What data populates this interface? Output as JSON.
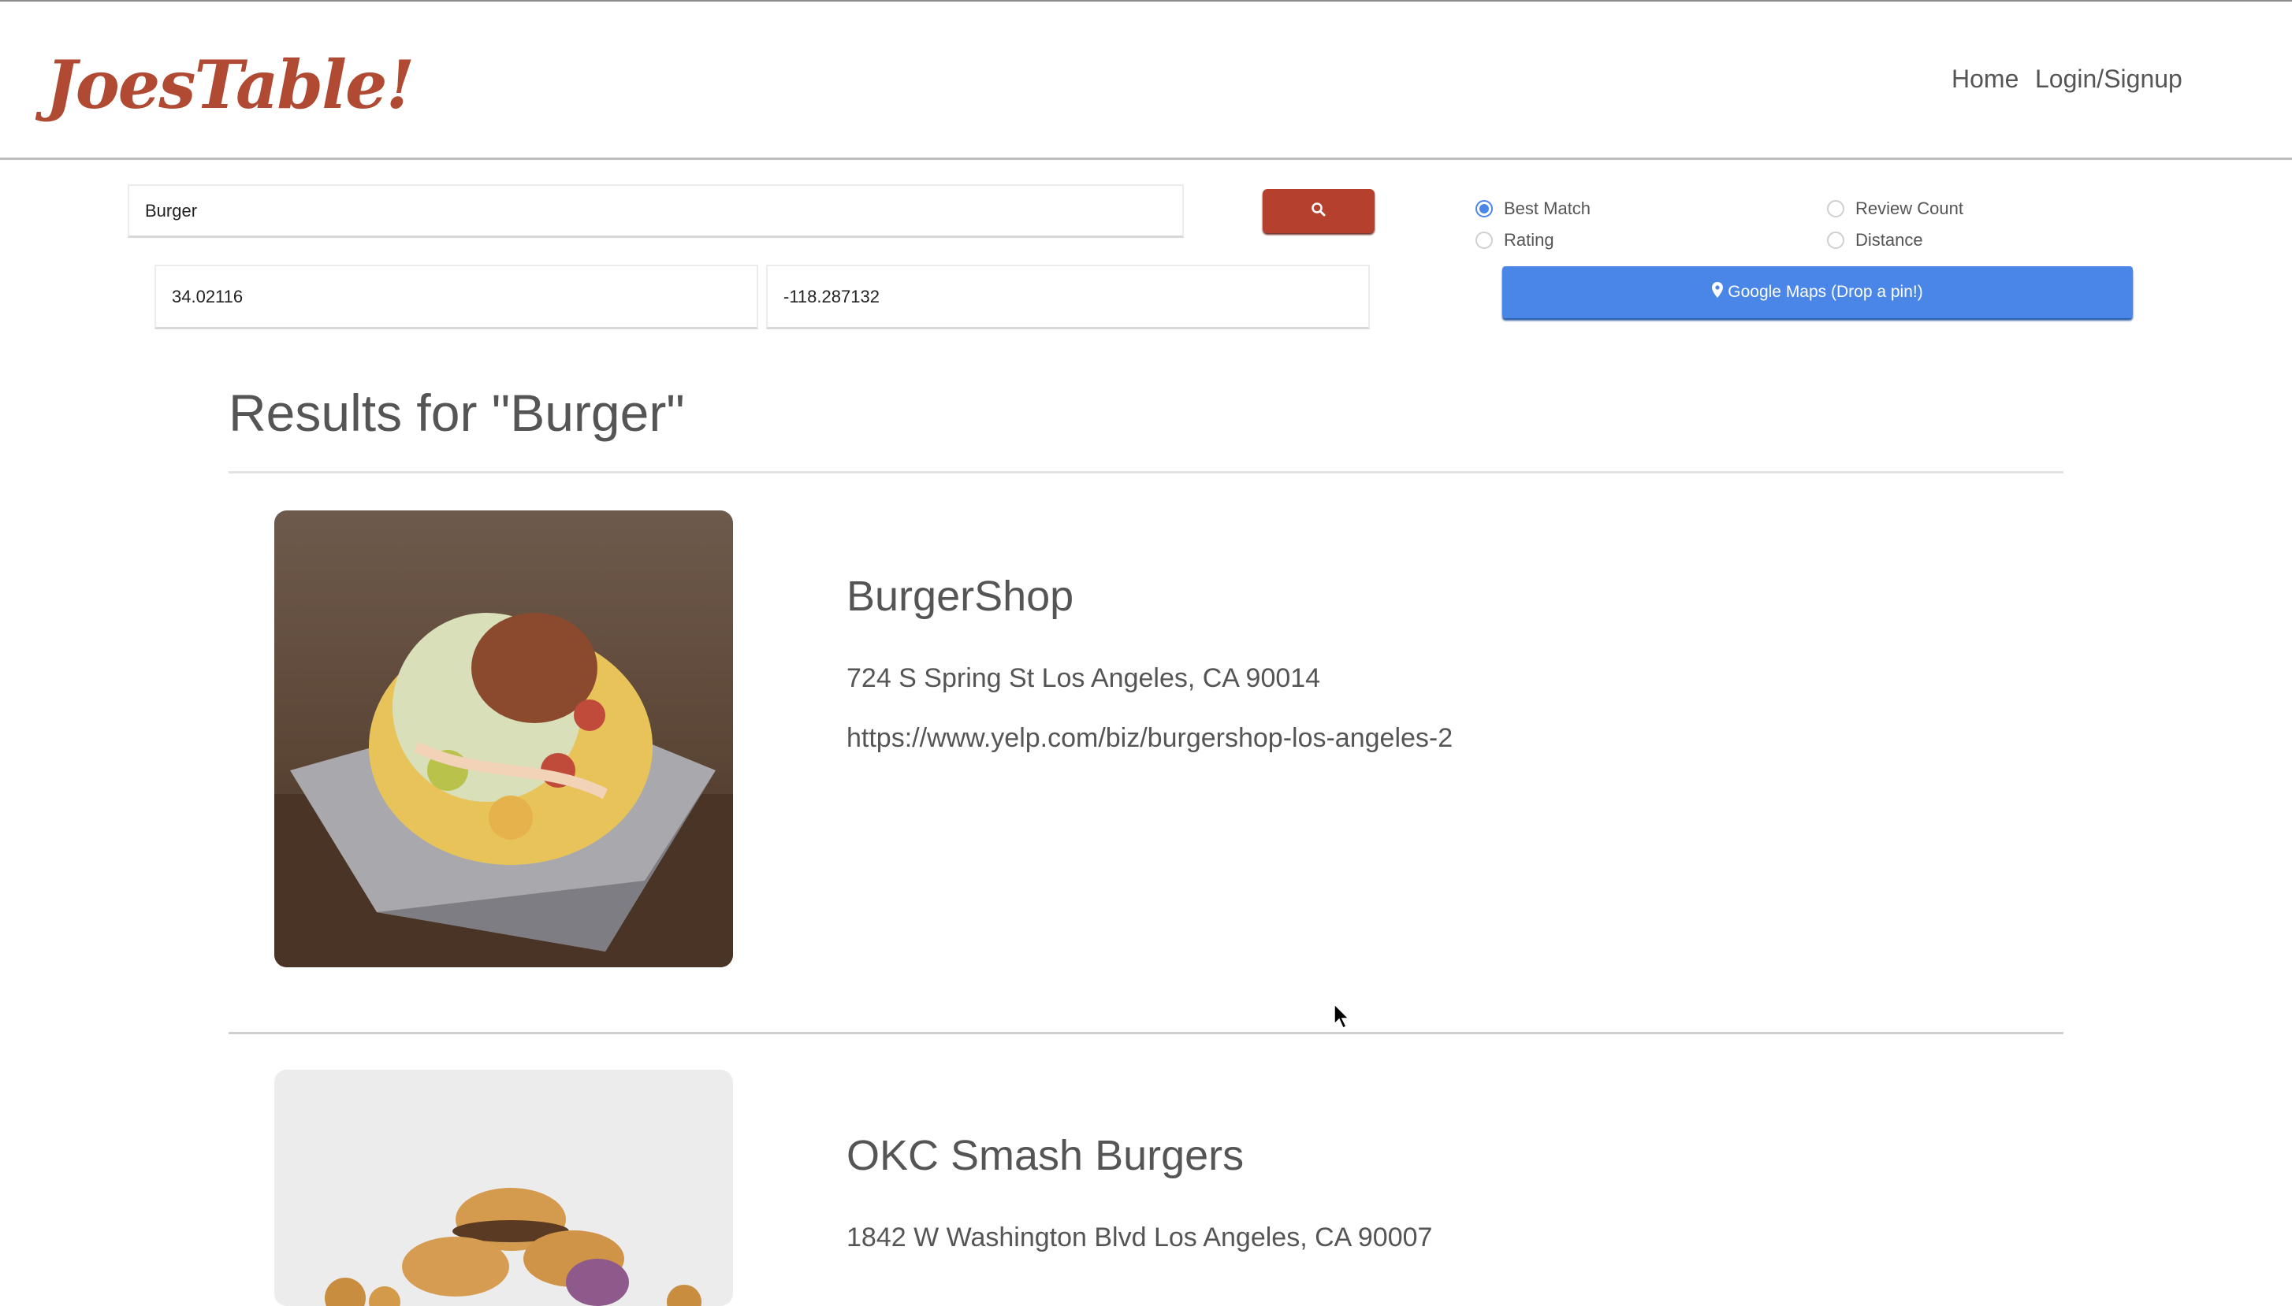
{
  "header": {
    "logo": "JoesTable!",
    "nav": {
      "home": "Home",
      "login": "Login/Signup"
    }
  },
  "search": {
    "query": "Burger",
    "latitude": "34.02116",
    "longitude": "-118.287132",
    "search_icon": "search-icon"
  },
  "sort": {
    "options": [
      {
        "label": "Best Match",
        "checked": true
      },
      {
        "label": "Rating",
        "checked": false
      },
      {
        "label": "Review Count",
        "checked": false
      },
      {
        "label": "Distance",
        "checked": false
      }
    ]
  },
  "maps_button": {
    "label": "Google Maps (Drop a pin!)",
    "icon": "map-marker-icon"
  },
  "results": {
    "title": "Results for \"Burger\"",
    "items": [
      {
        "name": "BurgerShop",
        "address": "724 S Spring St Los Angeles, CA 90014",
        "url": "https://www.yelp.com/biz/burgershop-los-angeles-2"
      },
      {
        "name": "OKC Smash Burgers",
        "address": "1842 W Washington Blvd Los Angeles, CA 90007"
      }
    ]
  },
  "colors": {
    "brand": "#b04a33",
    "search_button": "#b5402e",
    "maps_button": "#4a86e8"
  }
}
